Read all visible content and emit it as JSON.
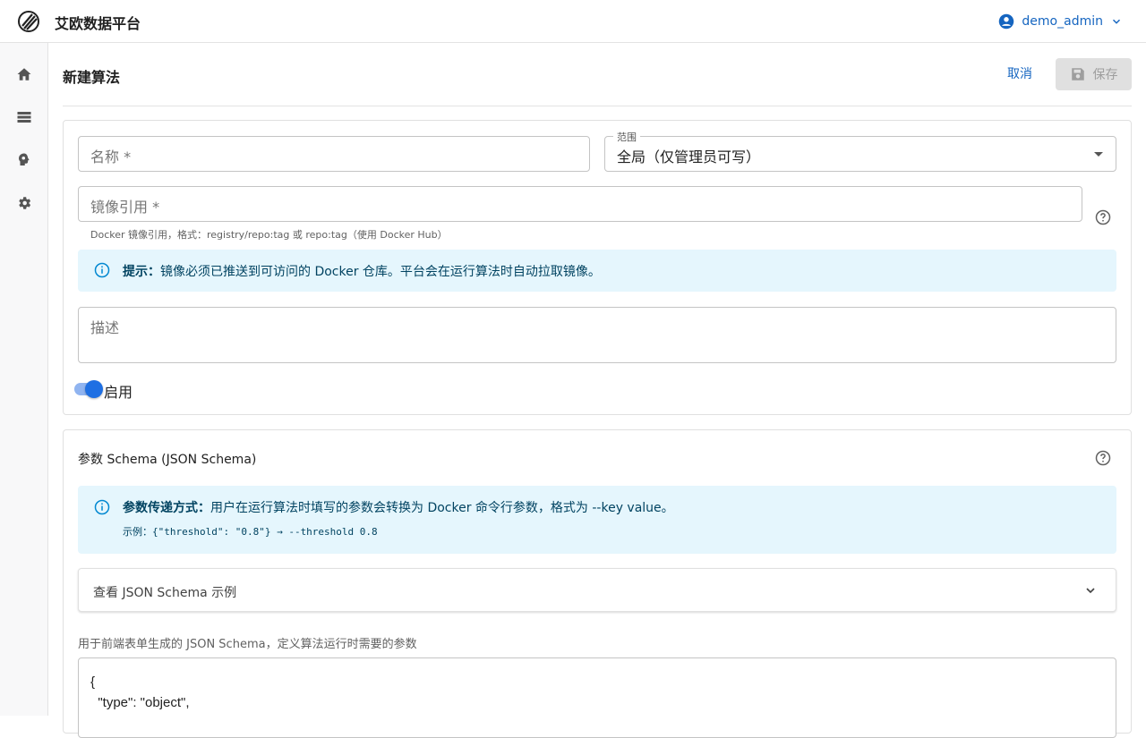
{
  "app": {
    "brand": "艾欧数据平台",
    "user": "demo_admin"
  },
  "sidebar": {
    "items": [
      {
        "icon": "home-icon"
      },
      {
        "icon": "storage-icon"
      },
      {
        "icon": "brain-icon"
      },
      {
        "icon": "settings-icon"
      }
    ]
  },
  "page": {
    "title": "新建算法",
    "cancel": "取消",
    "save": "保存"
  },
  "form": {
    "name_placeholder": "名称 *",
    "scope_label": "范围",
    "scope_value": "全局（仅管理员可写）",
    "image_placeholder": "镜像引用 *",
    "image_helper": "Docker 镜像引用，格式：registry/repo:tag 或 repo:tag（使用 Docker Hub）",
    "tip_bold": "提示：",
    "tip_text": "镜像必须已推送到可访问的 Docker 仓库。平台会在运行算法时自动拉取镜像。",
    "desc_placeholder": "描述",
    "enabled_label": "启用",
    "enabled": true
  },
  "schema": {
    "title": "参数 Schema (JSON Schema)",
    "info_bold": "参数传递方式：",
    "info_text": "用户在运行算法时填写的参数会转换为 Docker 命令行参数，格式为 --key value。",
    "example": "示例：{\"threshold\": \"0.8\"} → --threshold 0.8",
    "accordion": "查看 JSON Schema 示例",
    "note": "用于前端表单生成的 JSON Schema，定义算法运行时需要的参数",
    "code_lines": [
      "{",
      "  \"type\": \"object\","
    ]
  },
  "colors": {
    "accent": "#1565c0",
    "info_bg": "#e5f6fd",
    "switch": "#1e6fe3"
  }
}
